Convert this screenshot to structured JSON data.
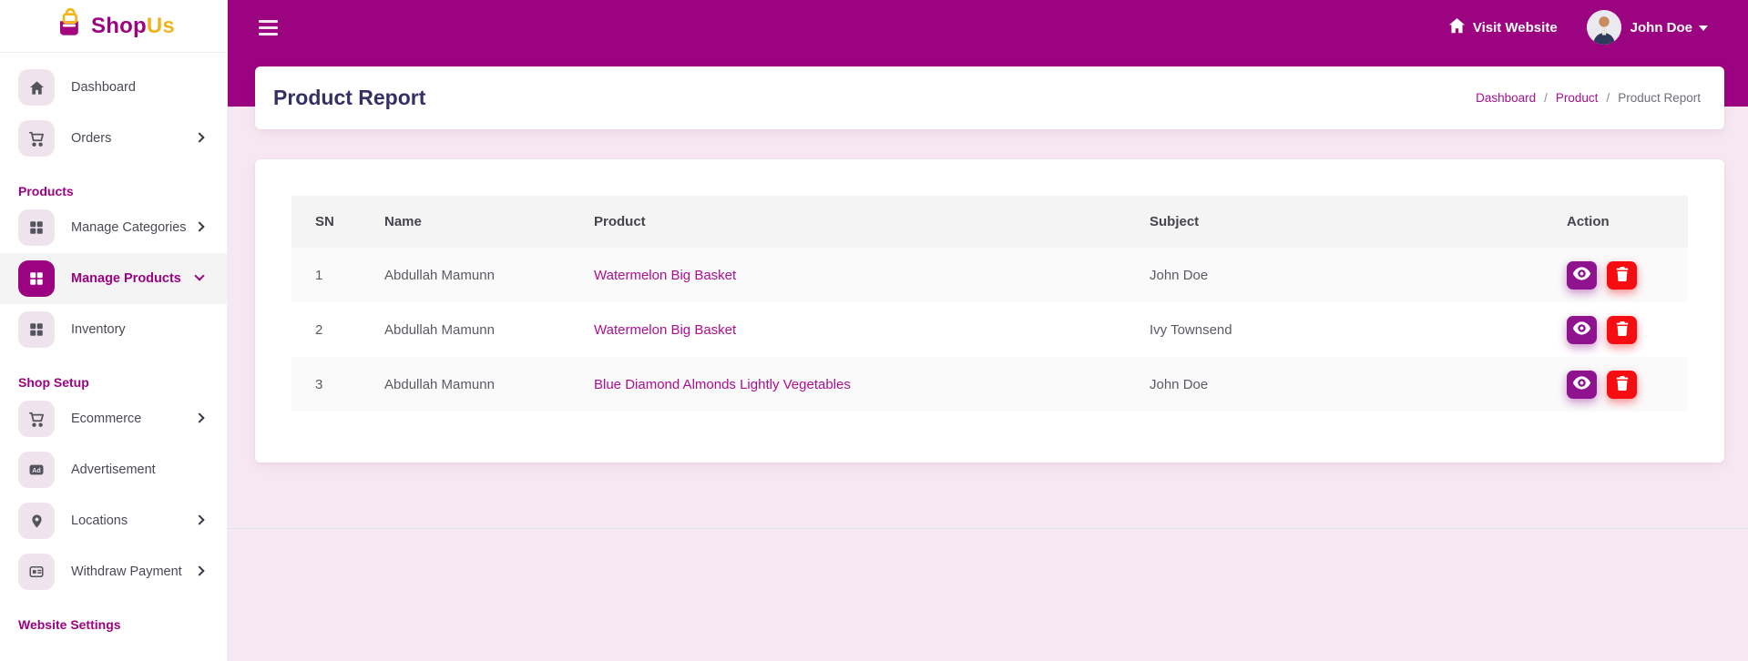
{
  "brand": {
    "name_primary": "Shop",
    "name_secondary": "Us"
  },
  "topbar": {
    "visit_website_label": "Visit Website",
    "user_name": "John Doe"
  },
  "sidebar": {
    "dashboard": "Dashboard",
    "orders": "Orders",
    "section_products": "Products",
    "manage_categories": "Manage Categories",
    "manage_products": "Manage Products",
    "inventory": "Inventory",
    "section_shop_setup": "Shop Setup",
    "ecommerce": "Ecommerce",
    "advertisement": "Advertisement",
    "locations": "Locations",
    "withdraw_payment": "Withdraw Payment",
    "section_website_settings": "Website Settings"
  },
  "page": {
    "title": "Product Report",
    "breadcrumb": [
      "Dashboard",
      "Product",
      "Product Report"
    ],
    "breadcrumb_separator": "/"
  },
  "table": {
    "headers": [
      "SN",
      "Name",
      "Product",
      "Subject",
      "Action"
    ],
    "rows": [
      {
        "sn": "1",
        "name": "Abdullah Mamunn",
        "product": "Watermelon Big Basket",
        "subject": "John Doe"
      },
      {
        "sn": "2",
        "name": "Abdullah Mamunn",
        "product": "Watermelon Big Basket",
        "subject": "Ivy Townsend"
      },
      {
        "sn": "3",
        "name": "Abdullah Mamunn",
        "product": "Blue Diamond Almonds Lightly Vegetables",
        "subject": "John Doe"
      }
    ]
  },
  "icons": {
    "logo": "shopping-bag-lock",
    "menu": "hamburger",
    "visit_website": "home",
    "user": "avatar",
    "user_dropdown": "caret-down",
    "dashboard": "home",
    "orders": "shopping-cart",
    "manage_categories": "grid",
    "manage_products": "grid",
    "inventory": "grid",
    "ecommerce": "shopping-cart",
    "advertisement": "ad-badge",
    "locations": "map-pin",
    "withdraw_payment": "payment-card",
    "view_action": "eye",
    "delete_action": "trash"
  },
  "colors": {
    "topbar": "#9C0380",
    "brand_primary": "#9C0380",
    "brand_secondary": "#F0B41E",
    "page_background": "#F6E8F3",
    "product_link": "#AE0D92",
    "view_button": "#8F128F",
    "delete_button": "#F50D11",
    "title": "#343063",
    "active_item_background": "#F4F4F4"
  }
}
